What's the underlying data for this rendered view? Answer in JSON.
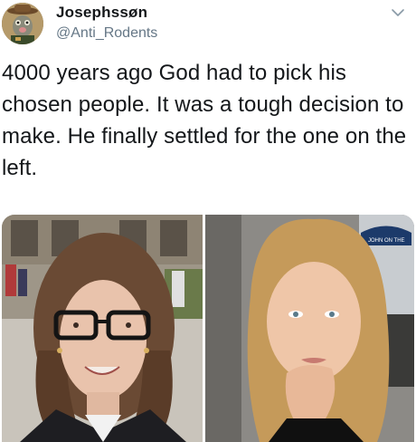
{
  "tweet": {
    "author": {
      "display_name": "Josephssøn",
      "handle": "@Anti_Rodents",
      "avatar_icon": "cartoon-rat-avatar"
    },
    "menu_icon": "chevron-down-icon",
    "text": "4000 years ago God had to pick his chosen people. It was a tough decision to make. He finally settled for the one on the left.",
    "media": [
      {
        "name": "left-photo",
        "description_icon": "woman-with-glasses-photo"
      },
      {
        "name": "right-photo",
        "description_icon": "woman-blonde-photo",
        "background_sign": "JOHN ON THE"
      }
    ]
  }
}
